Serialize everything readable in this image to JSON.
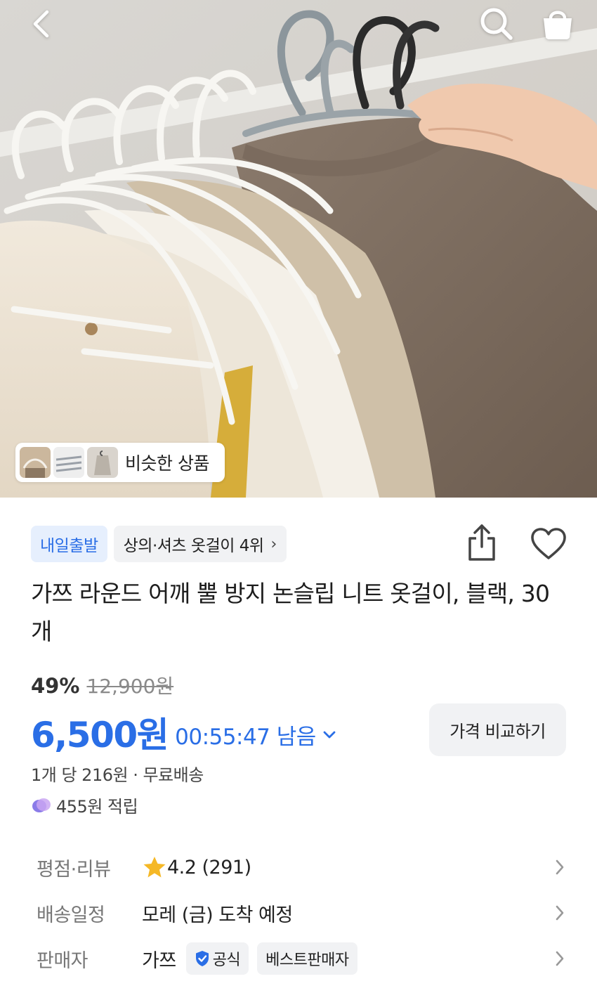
{
  "header": {
    "back_icon": "chevron-left-icon",
    "search_icon": "search-icon",
    "cart_icon": "shopping-bag-icon"
  },
  "hero": {
    "similar_products_label": "비슷한 상품"
  },
  "badges": {
    "delivery": "내일출발",
    "ranking": "상의·셔츠 옷걸이 4위"
  },
  "product": {
    "title": "가쯔 라운드 어깨 뿔 방지 논슬립 니트 옷걸이, 블랙, 30개"
  },
  "price": {
    "discount_rate": "49%",
    "original_price": "12,900원",
    "sale_price": "6,500원",
    "countdown": "00:55:47 남음",
    "compare_label": "가격 비교하기",
    "unit_info": "1개 당 216원 · 무료배송",
    "points": "455원 적립"
  },
  "details": {
    "rating_label": "평점·리뷰",
    "rating_value": "4.2 (291)",
    "shipping_label": "배송일정",
    "shipping_value": "모레 (금) 도착 예정",
    "seller_label": "판매자",
    "seller_value": "가쯔",
    "official_badge": "공식",
    "best_seller_badge": "베스트판매자"
  },
  "colors": {
    "accent_blue": "#2a6ee6",
    "badge_blue_bg": "#e6effd",
    "gray_bg": "#f1f2f4",
    "star": "#f5b826"
  }
}
